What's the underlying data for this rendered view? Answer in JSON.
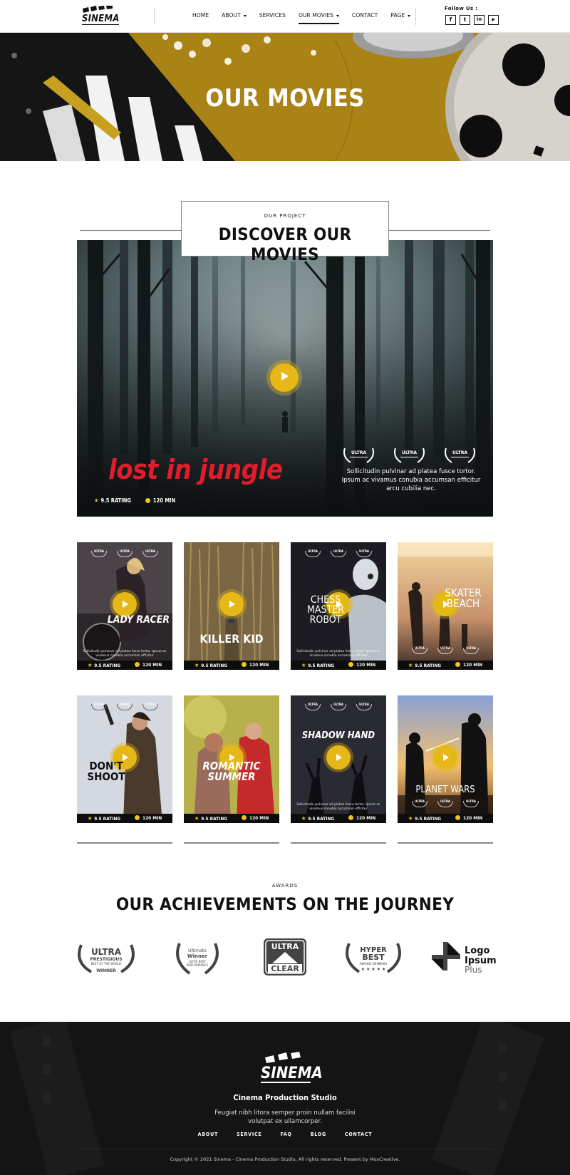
{
  "header": {
    "logo_text": "SINEMA",
    "nav": [
      {
        "label": "HOME",
        "has_caret": false,
        "active": false
      },
      {
        "label": "ABOUT",
        "has_caret": true,
        "active": false
      },
      {
        "label": "SERVICES",
        "has_caret": false,
        "active": false
      },
      {
        "label": "OUR MOVIES",
        "has_caret": true,
        "active": true
      },
      {
        "label": "CONTACT",
        "has_caret": false,
        "active": false
      },
      {
        "label": "PAGE",
        "has_caret": true,
        "active": false
      }
    ],
    "follow_label": "Follow Us :",
    "socials": [
      {
        "icon": "facebook-icon",
        "glyph": "f"
      },
      {
        "icon": "twitter-icon",
        "glyph": "t"
      },
      {
        "icon": "linkedin-icon",
        "glyph": "in"
      },
      {
        "icon": "youtube-icon",
        "glyph": "▶"
      }
    ]
  },
  "hero": {
    "title": "OUR MOVIES",
    "accent": "#b8901a"
  },
  "section": {
    "kicker": "OUR PROJECT",
    "title": "DISCOVER OUR MOVIES"
  },
  "feature": {
    "title": "lost in jungle",
    "rating": "9.5 RATING",
    "duration": "120 MIN",
    "awards": [
      "ULTRA",
      "ULTRA",
      "ULTRA"
    ],
    "description": "Sollicitudin pulvinar ad platea fusce tortor. Ipsum ac vivamus conubia accumsan efficitur arcu cubilia nec."
  },
  "card_common": {
    "rating": "9.5 RATING",
    "duration": "120 MIN",
    "desc": "Sollicitudin pulvinar ad platea fusce tortor. Ipsum ac vivamus conubia accumsan efficitur"
  },
  "movies": [
    {
      "title": "LADY RACER"
    },
    {
      "title": "KILLER KID"
    },
    {
      "title": "CHESS MASTER ROBOT"
    },
    {
      "title": "SKATER BEACH"
    },
    {
      "title": "DON'T SHOOT"
    },
    {
      "title": "ROMANTIC SUMMER"
    },
    {
      "title": "SHADOW HAND"
    },
    {
      "title": "PLANET WARS"
    }
  ],
  "awards": {
    "kicker": "AWARDS",
    "title": "OUR ACHIEVEMENTS ON THE JOURNEY",
    "logos": [
      {
        "line1": "ULTRA",
        "line2": "PRESTIGIOUS",
        "line3": "BEST OF THE WORLD",
        "line4": "WINNER"
      },
      {
        "line1": "Ultimate",
        "line2": "Winner",
        "line3": "ULTRA BEST",
        "line4": "PERFORMANCE"
      },
      {
        "line1": "ULTRA",
        "line2": "CLEAR"
      },
      {
        "line1": "HYPER",
        "line2": "BEST",
        "line3": "AWARD WINNING"
      },
      {
        "line1": "Logo",
        "line2": "Ipsum",
        "line3": "Plus"
      }
    ]
  },
  "footer": {
    "logo_text": "SINEMA",
    "studio": "Cinema Production Studio",
    "description": "Feugiat nibh litora semper proin nullam facilisi volutpat ex ullamcorper.",
    "nav": [
      "ABOUT",
      "SERVICE",
      "FAQ",
      "BLOG",
      "CONTACT"
    ],
    "copyright": "Copyright © 2021 Sinema - Cinema Production Studio, All rights reserved. Present by MoxCreative."
  },
  "colors": {
    "accent": "#e6b817",
    "dark": "#141414",
    "title_red": "#e21c2b"
  }
}
